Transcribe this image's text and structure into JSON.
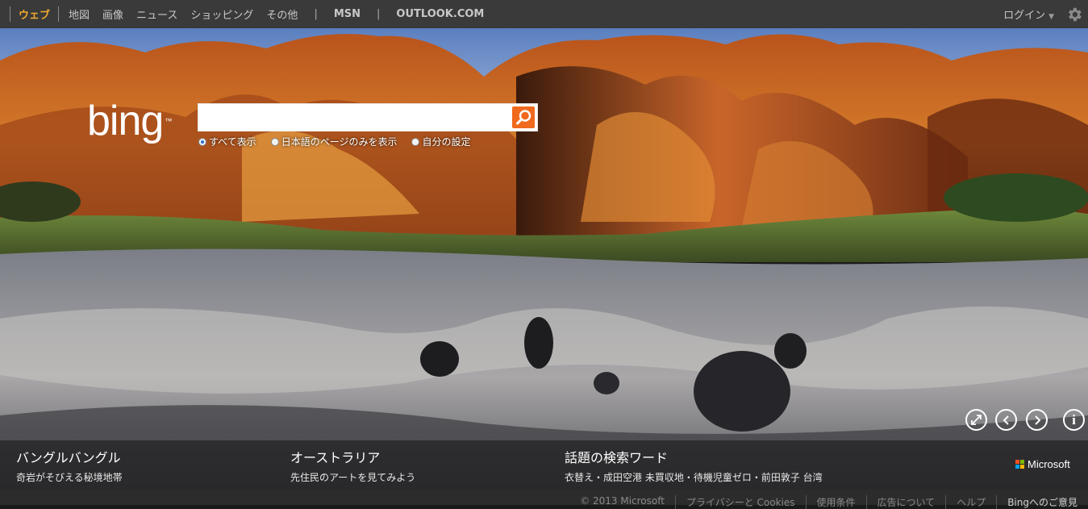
{
  "nav": {
    "items": [
      "ウェブ",
      "地図",
      "画像",
      "ニュース",
      "ショッピング",
      "その他"
    ],
    "separator": "|",
    "msn": "MSN",
    "outlook": "OUTLOOK.COM"
  },
  "account": {
    "login": "ログイン"
  },
  "brand": {
    "logo": "bing",
    "tm": "™"
  },
  "search": {
    "value": "",
    "placeholder": "",
    "scopes": [
      "すべて表示",
      "日本語のページのみを表示",
      "自分の設定"
    ],
    "selected_scope": 0
  },
  "info": {
    "items": [
      {
        "title": "バングルバングル",
        "subtitle": "奇岩がそびえる秘境地帯"
      },
      {
        "title": "オーストラリア",
        "subtitle": "先住民のアートを見てみよう"
      },
      {
        "title": "話題の検索ワード",
        "subtitle": "衣替え・成田空港 未買収地・待機児童ゼロ・前田敦子 台湾"
      }
    ]
  },
  "microsoft": "Microsoft",
  "footer": {
    "links": [
      "© 2013 Microsoft",
      "プライバシーと Cookies",
      "使用条件",
      "広告について",
      "ヘルプ",
      "Bingへのご意見"
    ]
  },
  "colors": {
    "accent": "#f0a830",
    "search_button": "#f06a1e",
    "topbar": "#3a3a3a",
    "ms_red": "#f25022",
    "ms_green": "#7fba00",
    "ms_blue": "#00a4ef",
    "ms_yellow": "#ffb900"
  },
  "icons": [
    "search-icon",
    "gear-icon",
    "fullscreen-icon",
    "chevron-left-icon",
    "chevron-right-icon",
    "info-icon",
    "microsoft-logo-icon"
  ]
}
